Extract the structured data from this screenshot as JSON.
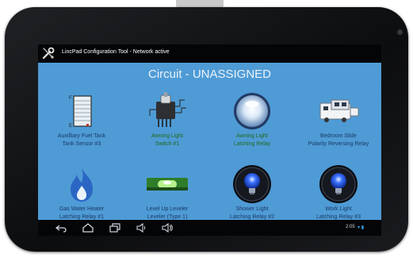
{
  "app": {
    "title": "LincPad Configuration Tool - Network active",
    "heading": "Circuit - UNASSIGNED"
  },
  "tiles": [
    {
      "line1": "Auxilliary Fuel Tank",
      "line2": "Tank Sensor #3",
      "color": "#1a3a66",
      "icon": "tank-gauge-icon"
    },
    {
      "line1": "Awning Light",
      "line2": "Switch #1",
      "color": "#1f6b1c",
      "icon": "switch-device-icon"
    },
    {
      "line1": "Awning Light",
      "line2": "Latching Relay",
      "color": "#1f6b1c",
      "icon": "light-globe-icon"
    },
    {
      "line1": "Bedroom Slide",
      "line2": "Polarity Reversing Relay",
      "color": "#1a3a66",
      "icon": "slide-out-icon"
    },
    {
      "line1": "Gas Water Heater",
      "line2": "Latching Relay #1",
      "color": "#1a3a66",
      "icon": "flame-icon"
    },
    {
      "line1": "Level Up Leveler",
      "line2": "Leveler (Type 1)",
      "color": "#1a3a66",
      "icon": "level-icon"
    },
    {
      "line1": "Shower Light",
      "line2": "Latching Relay #2",
      "color": "#1a3a66",
      "icon": "light-bulb-icon"
    },
    {
      "line1": "Work Light",
      "line2": "Latching Relay #3",
      "color": "#1a3a66",
      "icon": "light-bulb-icon"
    }
  ],
  "status_bar": {
    "time": "2:05",
    "icons": "wifi-icon battery-icon"
  },
  "colors": {
    "screen_background": "#4f9bd5",
    "bar_background": "#040507",
    "green_label": "#1f6b1c",
    "blue_label": "#1a3a66"
  }
}
